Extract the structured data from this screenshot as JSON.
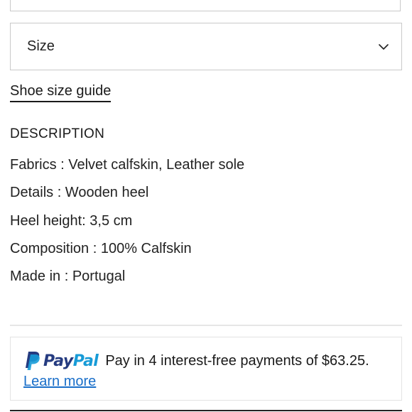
{
  "size_selector": {
    "label": "Size"
  },
  "size_guide": {
    "link_text": "Shoe size guide"
  },
  "description": {
    "heading": "DESCRIPTION",
    "items": [
      "Fabrics : Velvet calfskin, Leather sole",
      "Details : Wooden heel",
      "Heel height: 3,5 cm",
      "Composition : 100% Calfskin",
      "Made in : Portugal"
    ]
  },
  "paypal": {
    "brand_pay": "Pay",
    "brand_pal": "Pal",
    "message": "Pay in 4 interest-free payments of $63.25.",
    "learn_more": "Learn more",
    "colors": {
      "dark_blue": "#253b80",
      "light_blue": "#179bd7",
      "link": "#1a6fc9"
    }
  }
}
